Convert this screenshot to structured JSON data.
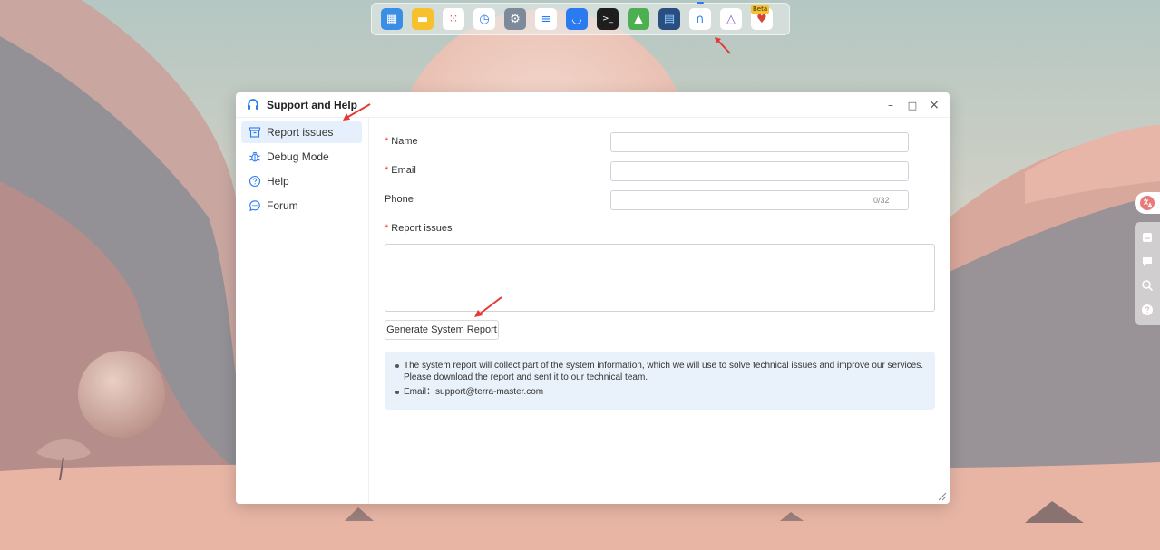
{
  "dock": {
    "apps": [
      {
        "name": "file-manager-icon",
        "bg": "#3a8ee6"
      },
      {
        "name": "notes-icon",
        "bg": "#f6c12b"
      },
      {
        "name": "app-grid-icon",
        "bg": "#ffffff"
      },
      {
        "name": "time-machine-icon",
        "bg": "#ffffff"
      },
      {
        "name": "settings-icon",
        "bg": "#7d8a99"
      },
      {
        "name": "storage-manager-icon",
        "bg": "#ffffff"
      },
      {
        "name": "app-center-icon",
        "bg": "#2b7bf0"
      },
      {
        "name": "terminal-icon",
        "bg": "#1e1e1e"
      },
      {
        "name": "security-advisor-icon",
        "bg": "#4caf50"
      },
      {
        "name": "docker-icon",
        "bg": "#2a4e7f"
      },
      {
        "name": "support-help-icon",
        "bg": "#ffffff",
        "active": true
      },
      {
        "name": "jellyfin-icon",
        "bg": "#ffffff"
      },
      {
        "name": "beta-app-icon",
        "bg": "#ffffff",
        "badge": "Beta"
      }
    ]
  },
  "window": {
    "title": "Support and Help",
    "controls": {
      "minimize": "–",
      "maximize": "□",
      "close": "×"
    }
  },
  "sidebar": {
    "items": [
      {
        "label": "Report issues",
        "icon": "archive-box-icon",
        "active": true
      },
      {
        "label": "Debug Mode",
        "icon": "bug-icon",
        "active": false
      },
      {
        "label": "Help",
        "icon": "question-circle-icon",
        "active": false
      },
      {
        "label": "Forum",
        "icon": "chat-bubble-icon",
        "active": false
      }
    ]
  },
  "form": {
    "required_mark": "*",
    "name_label": "Name",
    "name_value": "",
    "email_label": "Email",
    "email_value": "",
    "phone_label": "Phone",
    "phone_value": "",
    "phone_counter": "0/32",
    "report_label": "Report issues",
    "report_value": "",
    "generate_button": "Generate System Report"
  },
  "info": {
    "line1": "The system report will collect part of the system information, which we will use to solve technical issues and improve our services. Please download the report and sent it to our technical team.",
    "line2": "Email：support@terra-master.com"
  },
  "colors": {
    "accent": "#2b7bf0",
    "active_item_bg": "#e6f0fc",
    "info_bg": "#e9f1fb",
    "required": "#e53935",
    "annotation": "#e53935"
  }
}
